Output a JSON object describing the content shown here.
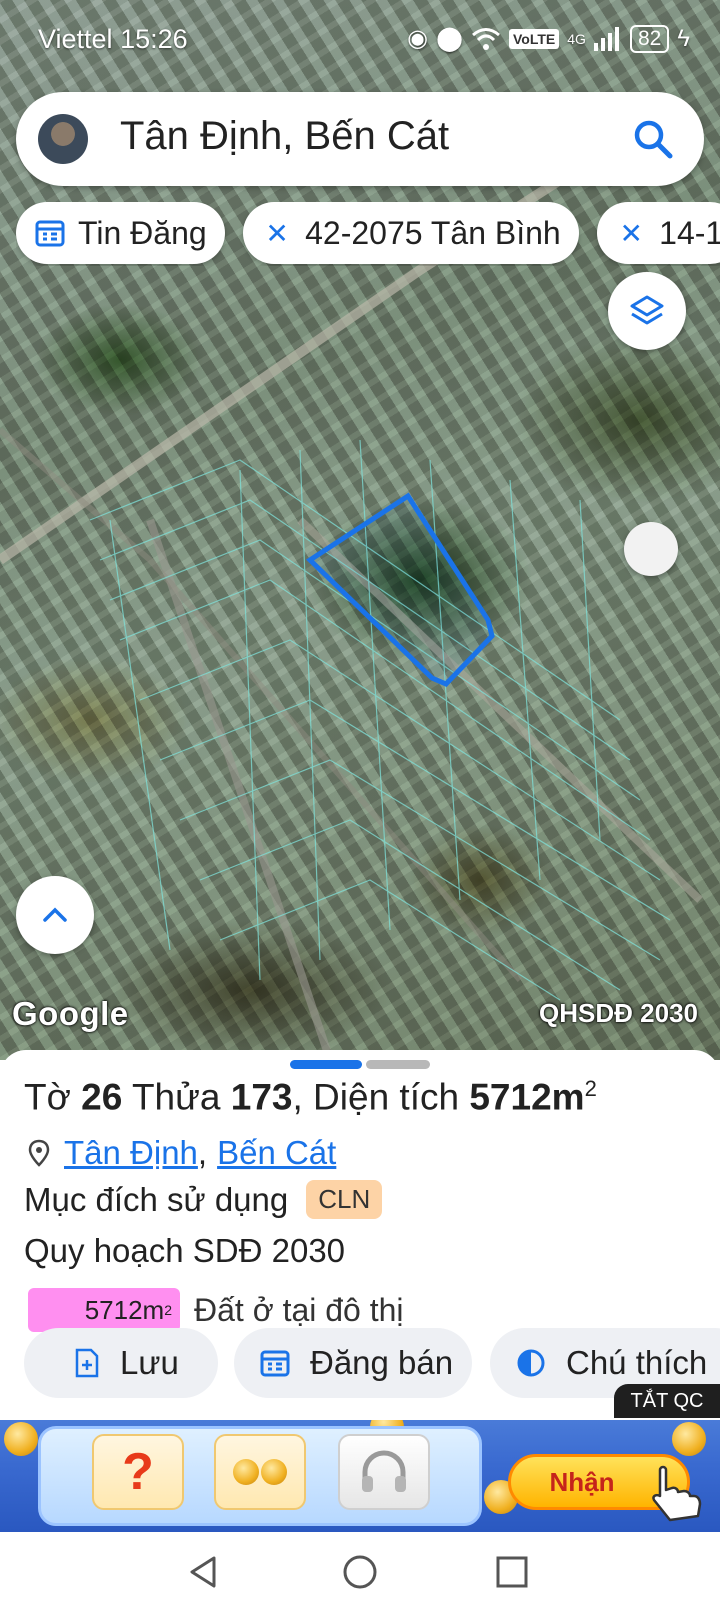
{
  "status": {
    "carrier": "Viettel",
    "time": "15:26",
    "volte": "VoLTE",
    "network": "4G",
    "battery": "82"
  },
  "search": {
    "text": "Tân Định, Bến Cát"
  },
  "chips": [
    {
      "label": "Tin Đăng",
      "icon": "calendar-icon"
    },
    {
      "label": "42-2075 Tân Bình",
      "icon": "ruler-icon"
    },
    {
      "label": "14-1",
      "icon": "ruler-icon"
    }
  ],
  "map": {
    "google_label": "Google",
    "plan_label": "QHSDĐ 2030",
    "highlight_color": "#1a73e8"
  },
  "parcel": {
    "sheet_prefix": "Tờ",
    "sheet_no": "26",
    "plot_prefix": "Thửa",
    "plot_no": "173",
    "area_prefix": "Diện tích",
    "area_value": "5712m",
    "area_sup": "2",
    "ward": "Tân Định",
    "separator": ",",
    "district": "Bến Cát",
    "purpose_label": "Mục đích sử dụng",
    "purpose_code": "CLN",
    "plan_title": "Quy hoạch SDĐ 2030",
    "plan_area": "5712m",
    "plan_area_sup": "2",
    "plan_desc": "Đất ở tại đô thị",
    "plan_color": "#ff8ff0"
  },
  "actions": [
    {
      "label": "Lưu",
      "icon": "save-icon"
    },
    {
      "label": "Đăng bán",
      "icon": "calendar-icon"
    },
    {
      "label": "Chú thích",
      "icon": "legend-icon"
    }
  ],
  "ad": {
    "close_label": "TẮT QC",
    "cta": "Nhận"
  }
}
